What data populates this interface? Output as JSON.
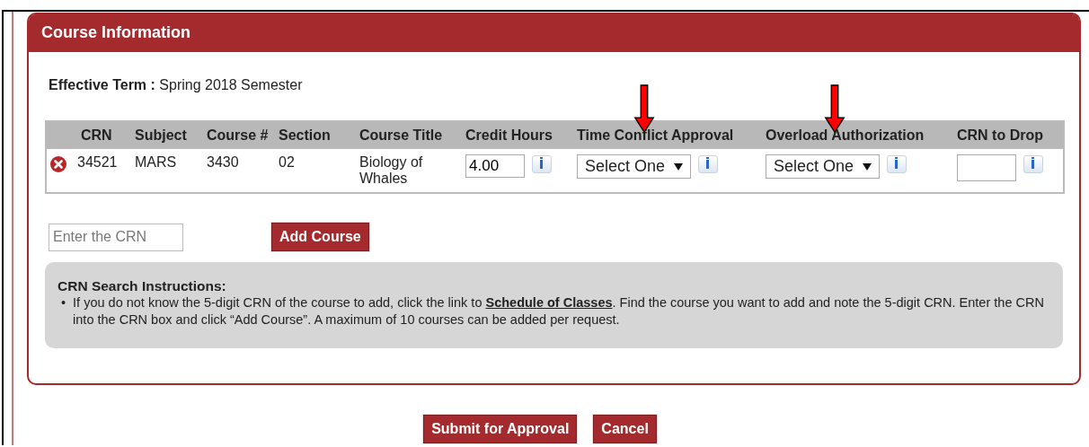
{
  "panel": {
    "title": "Course Information"
  },
  "effective_term": {
    "label": "Effective Term :",
    "value": "Spring 2018 Semester"
  },
  "table": {
    "columns": [
      {
        "label": "CRN",
        "marked": false
      },
      {
        "label": "Subject",
        "marked": false
      },
      {
        "label": "Course #",
        "marked": false
      },
      {
        "label": "Section",
        "marked": false
      },
      {
        "label": "Course Title",
        "marked": false
      },
      {
        "label": "Credit Hours",
        "marked": false
      },
      {
        "label": "Time Conflict Approval",
        "marked": true
      },
      {
        "label": "Overload Authorization",
        "marked": true
      },
      {
        "label": "CRN to Drop",
        "marked": false
      }
    ],
    "rows": [
      {
        "crn": "34521",
        "subject": "MARS",
        "course_number": "3430",
        "section": "02",
        "course_title": "Biology of Whales",
        "credit_hours": "4.00",
        "time_conflict_approval": "Select One",
        "overload_authorization": "Select One"
      }
    ]
  },
  "crn_entry": {
    "placeholder": "Enter the CRN"
  },
  "add_button": "Add Course",
  "instructions": {
    "title": "CRN Search Instructions:",
    "items": [
      {
        "marker": "•",
        "before": "If you do not know the 5-digit CRN of the course to add, click the link to ",
        "link": "Schedule of Classes",
        "after": ". Find the course you want to add and note the 5-digit CRN. Enter the CRN into the CRN box and click “Add Course”. A maximum of 10 courses can be added per request."
      }
    ]
  },
  "buttons": [
    {
      "label": "Submit for Approval"
    },
    {
      "label": "Cancel"
    }
  ]
}
